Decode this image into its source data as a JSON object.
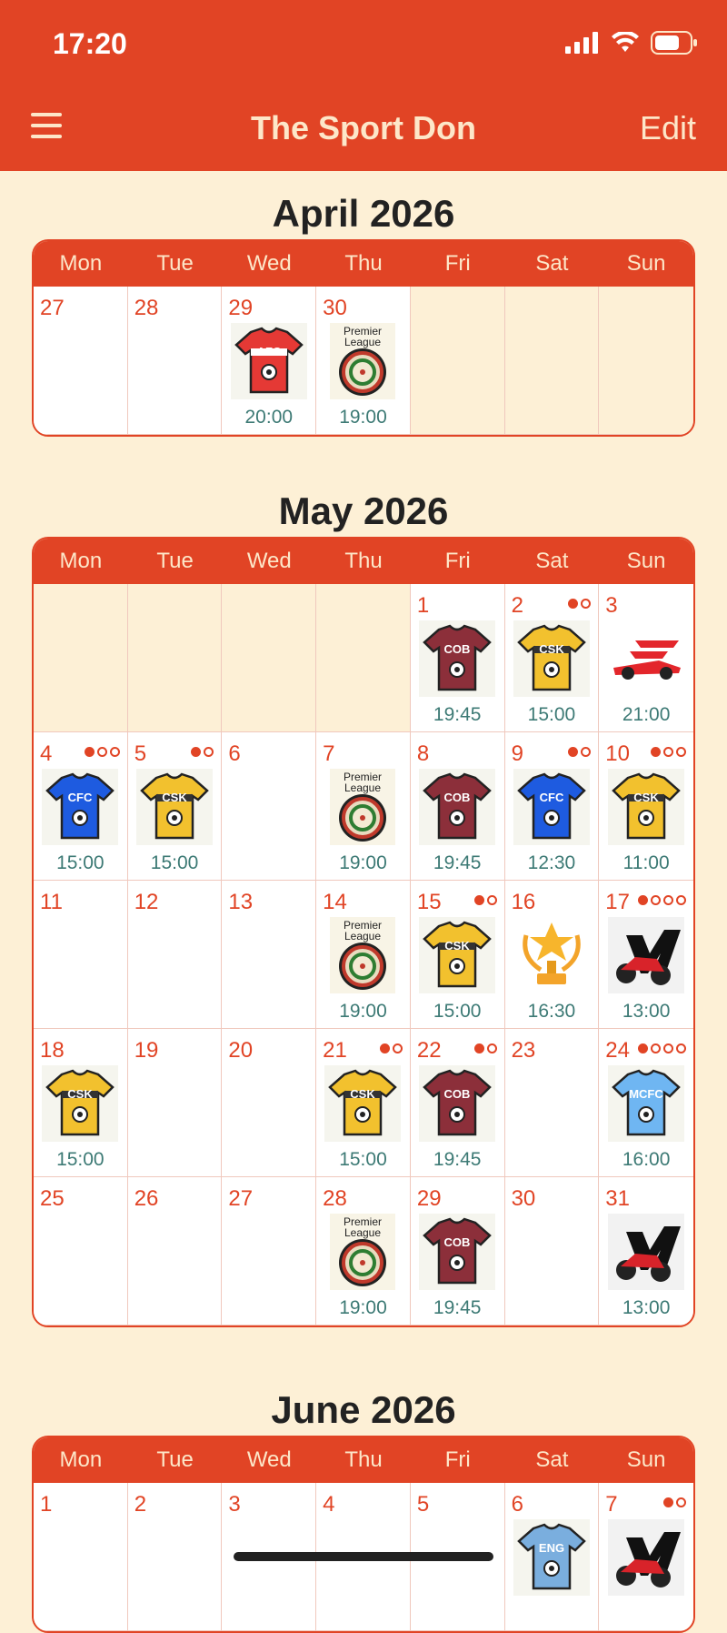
{
  "status": {
    "time": "17:20"
  },
  "nav": {
    "title": "The Sport Don",
    "edit": "Edit"
  },
  "weekdays": [
    "Mon",
    "Tue",
    "Wed",
    "Thu",
    "Fri",
    "Sat",
    "Sun"
  ],
  "months": [
    {
      "title": "April 2026",
      "rows": [
        [
          {
            "day": "27"
          },
          {
            "day": "28"
          },
          {
            "day": "29",
            "icon": "arsenal-shirt-icon",
            "time": "20:00"
          },
          {
            "day": "30",
            "icon": "darts-board-icon",
            "time": "19:00"
          },
          {
            "day": "",
            "empty": true
          },
          {
            "day": "",
            "empty": true
          },
          {
            "day": "",
            "empty": true
          }
        ]
      ]
    },
    {
      "title": "May 2026",
      "rows": [
        [
          {
            "day": "",
            "empty": true
          },
          {
            "day": "",
            "empty": true
          },
          {
            "day": "",
            "empty": true
          },
          {
            "day": "",
            "empty": true
          },
          {
            "day": "1",
            "icon": "maroon-shirt-icon",
            "time": "19:45"
          },
          {
            "day": "2",
            "icon": "yellow-shirt-icon",
            "time": "15:00",
            "dots": [
              1,
              0
            ]
          },
          {
            "day": "3",
            "icon": "f1-car-icon",
            "time": "21:00"
          }
        ],
        [
          {
            "day": "4",
            "icon": "blue-shirt-icon",
            "time": "15:00",
            "dots": [
              1,
              0,
              0
            ]
          },
          {
            "day": "5",
            "icon": "yellow-shirt-icon",
            "time": "15:00",
            "dots": [
              1,
              0
            ]
          },
          {
            "day": "6"
          },
          {
            "day": "7",
            "icon": "darts-board-icon",
            "time": "19:00"
          },
          {
            "day": "8",
            "icon": "maroon-shirt-icon",
            "time": "19:45"
          },
          {
            "day": "9",
            "icon": "blue-shirt-icon",
            "time": "12:30",
            "dots": [
              1,
              0
            ]
          },
          {
            "day": "10",
            "icon": "yellow-shirt-icon",
            "time": "11:00",
            "dots": [
              1,
              0,
              0
            ]
          }
        ],
        [
          {
            "day": "11"
          },
          {
            "day": "12"
          },
          {
            "day": "13"
          },
          {
            "day": "14",
            "icon": "darts-board-icon",
            "time": "19:00"
          },
          {
            "day": "15",
            "icon": "yellow-shirt-icon",
            "time": "15:00",
            "dots": [
              1,
              0
            ]
          },
          {
            "day": "16",
            "icon": "trophy-icon",
            "time": "16:30"
          },
          {
            "day": "17",
            "icon": "motorbike-icon",
            "time": "13:00",
            "dots": [
              1,
              0,
              0,
              0
            ]
          }
        ],
        [
          {
            "day": "18",
            "icon": "yellow-shirt-icon",
            "time": "15:00"
          },
          {
            "day": "19"
          },
          {
            "day": "20"
          },
          {
            "day": "21",
            "icon": "yellow-shirt-icon",
            "time": "15:00",
            "dots": [
              1,
              0
            ]
          },
          {
            "day": "22",
            "icon": "maroon-shirt-icon",
            "time": "19:45",
            "dots": [
              1,
              0
            ]
          },
          {
            "day": "23"
          },
          {
            "day": "24",
            "icon": "light-blue-shirt-icon",
            "time": "16:00",
            "dots": [
              1,
              0,
              0,
              0
            ]
          }
        ],
        [
          {
            "day": "25"
          },
          {
            "day": "26"
          },
          {
            "day": "27"
          },
          {
            "day": "28",
            "icon": "darts-board-icon",
            "time": "19:00"
          },
          {
            "day": "29",
            "icon": "maroon-shirt-icon",
            "time": "19:45"
          },
          {
            "day": "30"
          },
          {
            "day": "31",
            "icon": "motorbike-icon",
            "time": "13:00"
          }
        ]
      ]
    },
    {
      "title": "June 2026",
      "rows": [
        [
          {
            "day": "1"
          },
          {
            "day": "2"
          },
          {
            "day": "3"
          },
          {
            "day": "4"
          },
          {
            "day": "5"
          },
          {
            "day": "6",
            "icon": "eng-shirt-icon"
          },
          {
            "day": "7",
            "icon": "motorbike-icon",
            "dots": [
              1,
              0
            ]
          }
        ]
      ]
    }
  ],
  "shirt_labels": {
    "arsenal": "AFC",
    "maroon": "COB",
    "yellow": "CSK",
    "blue": "CFC",
    "lightblue": "MCFC",
    "eng": "ENG"
  },
  "darts_label_1": "Premier",
  "darts_label_2": "League"
}
